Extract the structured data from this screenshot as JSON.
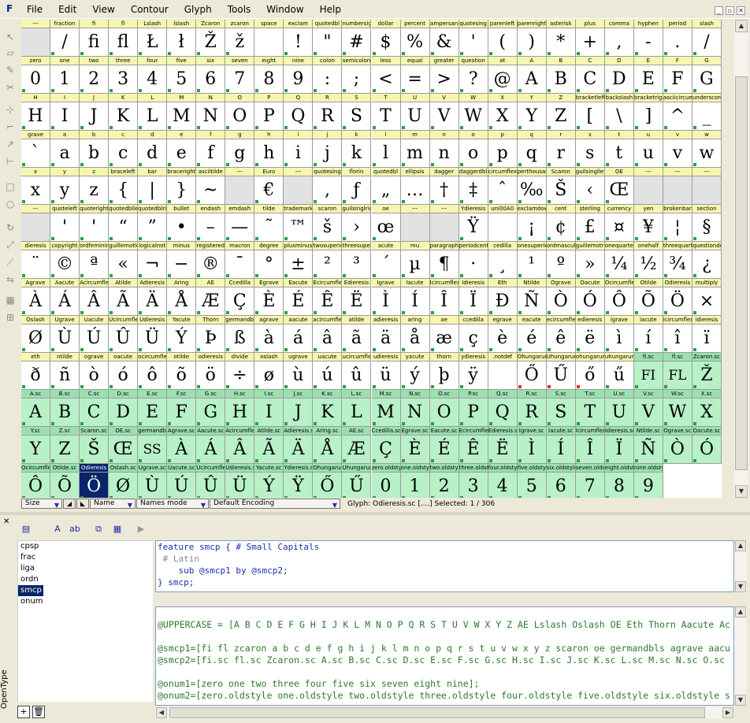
{
  "app": {
    "logo": "F",
    "menus": [
      "File",
      "Edit",
      "View",
      "Contour",
      "Glyph",
      "Tools",
      "Window",
      "Help"
    ]
  },
  "window_controls": [
    "minimize-icon",
    "restore-icon",
    "close-icon"
  ],
  "left_tools": [
    "pointer-icon",
    "eraser-icon",
    "pencil-icon",
    "knife-icon",
    "curve-point-icon",
    "corner-point-icon",
    "tangent-point-icon",
    "hv-point-icon",
    "rectangle-icon",
    "ellipse-icon",
    "rotate-icon",
    "scale-icon",
    "skew-icon",
    "flip-icon",
    "metrics-icon",
    "kern-icon"
  ],
  "glyph_grid": {
    "rows": [
      {
        "labels": [
          "---",
          "fraction",
          "fi",
          "fl",
          "Lslash",
          "lslash",
          "Zcaron",
          "zcaron",
          "space",
          "exclam",
          "quotedbl",
          "numbersig",
          "dollar",
          "percent",
          "ampersan",
          "quotesing",
          "parenleft",
          "parenright",
          "asterisk",
          "plus",
          "comma",
          "hyphen",
          "period",
          "slash"
        ],
        "glyphs": [
          "",
          "/",
          "fi",
          "fl",
          "Ł",
          "ł",
          "Ž",
          "ž",
          "",
          "!",
          "\"",
          "#",
          "$",
          "%",
          "&",
          "'",
          "(",
          ")",
          "*",
          "+",
          ",",
          "-",
          ".",
          "/"
        ]
      },
      {
        "labels": [
          "zero",
          "one",
          "two",
          "three",
          "four",
          "five",
          "six",
          "seven",
          "eight",
          "nine",
          "colon",
          "semicolon",
          "less",
          "equal",
          "greater",
          "question",
          "at",
          "A",
          "B",
          "C",
          "D",
          "E",
          "F",
          "G"
        ],
        "glyphs": [
          "0",
          "1",
          "2",
          "3",
          "4",
          "5",
          "6",
          "7",
          "8",
          "9",
          ":",
          ";",
          "<",
          "=",
          ">",
          "?",
          "@",
          "A",
          "B",
          "C",
          "D",
          "E",
          "F",
          "G"
        ]
      },
      {
        "labels": [
          "H",
          "I",
          "J",
          "K",
          "L",
          "M",
          "N",
          "O",
          "P",
          "Q",
          "R",
          "S",
          "T",
          "U",
          "V",
          "W",
          "X",
          "Y",
          "Z",
          "bracketleft",
          "backslash",
          "bracketright",
          "asciicircum",
          "underscore"
        ],
        "glyphs": [
          "H",
          "I",
          "J",
          "K",
          "L",
          "M",
          "N",
          "O",
          "P",
          "Q",
          "R",
          "S",
          "T",
          "U",
          "V",
          "W",
          "X",
          "Y",
          "Z",
          "[",
          "\\",
          "]",
          "^",
          "_"
        ]
      },
      {
        "labels": [
          "grave",
          "a",
          "b",
          "c",
          "d",
          "e",
          "f",
          "g",
          "h",
          "i",
          "j",
          "k",
          "l",
          "m",
          "n",
          "o",
          "p",
          "q",
          "r",
          "s",
          "t",
          "u",
          "v",
          "w"
        ],
        "glyphs": [
          "`",
          "a",
          "b",
          "c",
          "d",
          "e",
          "f",
          "g",
          "h",
          "i",
          "j",
          "k",
          "l",
          "m",
          "n",
          "o",
          "p",
          "q",
          "r",
          "s",
          "t",
          "u",
          "v",
          "w"
        ]
      },
      {
        "labels": [
          "x",
          "y",
          "z",
          "braceleft",
          "bar",
          "braceright",
          "asciitilde",
          "---",
          "Euro",
          "---",
          "quotesing",
          "florin",
          "quotedbl",
          "ellipsis",
          "dagger",
          "daggerdbl",
          "circumflex",
          "perthousand",
          "Scaron",
          "guilsinglleft",
          "OE",
          "---",
          "---",
          "---"
        ],
        "glyphs": [
          "x",
          "y",
          "z",
          "{",
          "|",
          "}",
          "~",
          "",
          "€",
          "",
          "‚",
          "ƒ",
          "„",
          "…",
          "†",
          "‡",
          "ˆ",
          "‰",
          "Š",
          "‹",
          "Œ",
          "",
          "",
          ""
        ]
      },
      {
        "labels": [
          "---",
          "quoteleft",
          "quoteright",
          "quotedblleft",
          "quotedblright",
          "bullet",
          "endash",
          "emdash",
          "tilde",
          "trademark",
          "scaron",
          "guilsinglright",
          "oe",
          "---",
          "---",
          "Ydieresis",
          "uni00A0",
          "exclamdown",
          "cent",
          "sterling",
          "currency",
          "yen",
          "brokenbar",
          "section"
        ],
        "glyphs": [
          "",
          "'",
          "'",
          "“",
          "”",
          "•",
          "–",
          "—",
          "˜",
          "™",
          "š",
          "›",
          "œ",
          "",
          "",
          "Ÿ",
          "",
          "¡",
          "¢",
          "£",
          "¤",
          "¥",
          "¦",
          "§"
        ]
      },
      {
        "labels": [
          "dieresis",
          "copyright",
          "ordfeminine",
          "guillemotleft",
          "logicalnot",
          "minus",
          "registered",
          "macron",
          "degree",
          "plusminus",
          "twosuperior",
          "threesuperior",
          "acute",
          "mu",
          "paragraph",
          "periodcentered",
          "cedilla",
          "onesuperior",
          "ordmasculine",
          "guillemotright",
          "onequarter",
          "onehalf",
          "threequarters",
          "questiondown"
        ],
        "glyphs": [
          "¨",
          "©",
          "ª",
          "«",
          "¬",
          "−",
          "®",
          "¯",
          "°",
          "±",
          "²",
          "³",
          "´",
          "µ",
          "¶",
          "·",
          "¸",
          "¹",
          "º",
          "»",
          "¼",
          "½",
          "¾",
          "¿"
        ]
      },
      {
        "labels": [
          "Agrave",
          "Aacute",
          "Acircumflex",
          "Atilde",
          "Adieresis",
          "Aring",
          "AE",
          "Ccedilla",
          "Egrave",
          "Eacute",
          "Ecircumflex",
          "Edieresis",
          "Igrave",
          "Iacute",
          "Icircumflex",
          "Idieresis",
          "Eth",
          "Ntilde",
          "Ograve",
          "Oacute",
          "Ocircumflex",
          "Otilde",
          "Odieresis",
          "multiply"
        ],
        "glyphs": [
          "À",
          "Á",
          "Â",
          "Ã",
          "Ä",
          "Å",
          "Æ",
          "Ç",
          "È",
          "É",
          "Ê",
          "Ë",
          "Ì",
          "Í",
          "Î",
          "Ï",
          "Ð",
          "Ñ",
          "Ò",
          "Ó",
          "Ô",
          "Õ",
          "Ö",
          "×"
        ]
      },
      {
        "labels": [
          "Oslash",
          "Ugrave",
          "Uacute",
          "Ucircumflex",
          "Udieresis",
          "Yacute",
          "Thorn",
          "germandbls",
          "agrave",
          "aacute",
          "acircumflex",
          "atilde",
          "adieresis",
          "aring",
          "ae",
          "ccedilla",
          "egrave",
          "eacute",
          "ecircumflex",
          "edieresis",
          "igrave",
          "iacute",
          "icircumflex",
          "idieresis"
        ],
        "glyphs": [
          "Ø",
          "Ù",
          "Ú",
          "Û",
          "Ü",
          "Ý",
          "Þ",
          "ß",
          "à",
          "á",
          "â",
          "ã",
          "ä",
          "å",
          "æ",
          "ç",
          "è",
          "é",
          "ê",
          "ë",
          "ì",
          "í",
          "î",
          "ï"
        ]
      },
      {
        "labels": [
          "eth",
          "ntilde",
          "ograve",
          "oacute",
          "ocircumflex",
          "otilde",
          "odieresis",
          "divide",
          "oslash",
          "ugrave",
          "uacute",
          "ucircumflex",
          "udieresis",
          "yacute",
          "thorn",
          "ydieresis",
          ".notdef",
          "Ohungarumlaut",
          "Uhungarumlaut",
          "ohungarumlaut",
          "uhungarumlaut",
          "fi.sc",
          "fl.sc",
          "Zcaron.sc"
        ],
        "glyphs": [
          "ð",
          "ñ",
          "ò",
          "ó",
          "ô",
          "õ",
          "ö",
          "÷",
          "ø",
          "ù",
          "ú",
          "û",
          "ü",
          "ý",
          "þ",
          "ÿ",
          "",
          "Ő",
          "Ű",
          "ő",
          "ű",
          "FI",
          "FL",
          "Ž"
        ]
      },
      {
        "labels": [
          "A.sc",
          "B.sc",
          "C.sc",
          "D.sc",
          "E.sc",
          "F.sc",
          "G.sc",
          "H.sc",
          "I.sc",
          "J.sc",
          "K.sc",
          "L.sc",
          "M.sc",
          "N.sc",
          "O.sc",
          "P.sc",
          "Q.sc",
          "R.sc",
          "S.sc",
          "T.sc",
          "U.sc",
          "V.sc",
          "W.sc",
          "X.sc"
        ],
        "glyphs": [
          "A",
          "B",
          "C",
          "D",
          "E",
          "F",
          "G",
          "H",
          "I",
          "J",
          "K",
          "L",
          "M",
          "N",
          "O",
          "P",
          "Q",
          "R",
          "S",
          "T",
          "U",
          "V",
          "W",
          "X"
        ]
      },
      {
        "labels": [
          "Y.sc",
          "Z.sc",
          "Scaron.sc",
          "OE.sc",
          "germandbls.sc",
          "Agrave.sc",
          "Aacute.sc",
          "Acircumflex.sc",
          "Atilde.sc",
          "Adieresis.sc",
          "Aring.sc",
          "AE.sc",
          "Ccedilla.sc",
          "Egrave.sc",
          "Eacute.sc",
          "Ecircumflex.sc",
          "Edieresis.sc",
          "Igrave.sc",
          "Iacute.sc",
          "Icircumflex.sc",
          "Idieresis.sc",
          "Ntilde.sc",
          "Ograve.sc",
          "Oacute.sc"
        ],
        "glyphs": [
          "Y",
          "Z",
          "Š",
          "Œ",
          "SS",
          "À",
          "Á",
          "Â",
          "Ã",
          "Ä",
          "Å",
          "Æ",
          "Ç",
          "È",
          "É",
          "Ê",
          "Ë",
          "Ì",
          "Í",
          "Î",
          "Ï",
          "Ñ",
          "Ò",
          "Ó"
        ]
      },
      {
        "labels": [
          "Ocircumflex.sc",
          "Otilde.sc",
          "Odieresis",
          "Oslash.sc",
          "Ugrave.sc",
          "Uacute.sc",
          "Ucircumflex.sc",
          "Udieresis.sc",
          "Yacute.sc",
          "Ydieresis.sc",
          "Ohungarumlaut.sc",
          "Uhungarumlaut.sc",
          "zero.oldstyle",
          "one.oldstyle",
          "two.oldstyle",
          "three.oldstyle",
          "four.oldstyle",
          "five.oldstyle",
          "six.oldstyle",
          "seven.oldstyle",
          "eight.oldstyle",
          "nine.oldstyle"
        ],
        "glyphs": [
          "Ô",
          "Õ",
          "Ö",
          "Ø",
          "Ù",
          "Ú",
          "Û",
          "Ü",
          "Ý",
          "Ÿ",
          "Ő",
          "Ű",
          "0",
          "1",
          "2",
          "3",
          "4",
          "5",
          "6",
          "7",
          "8",
          "9"
        ]
      }
    ],
    "highlight_color": "#f6f6b0",
    "sc_color": "#b8f0c8",
    "sc_label_color": "#9be0b0",
    "selected_color": "#0a246a",
    "empty_color": "#e2e2e2"
  },
  "statusbar": {
    "size": "Size",
    "name": "Name",
    "names_mode": "Names mode",
    "encoding": "Default Encoding",
    "glyph_info": "Glyph: Odieresis.sc [....]   Selected: 1 / 306"
  },
  "panel": {
    "tab_label": "OpenType",
    "features": [
      "cpsp",
      "frac",
      "liga",
      "ordn",
      "smcp",
      "onum"
    ],
    "selected_feature": "smcp",
    "code_lines": [
      "feature smcp { # Small Capitals",
      " # Latin",
      "    sub @smcp1 by @smcp2;",
      "} smcp;"
    ],
    "class_lines": [
      "",
      "@UPPERCASE = [A B C D E F G H I J K L M N O P Q R S T U V W X Y Z AE Lslash Oslash OE Eth Thorn Aacute Ac",
      "",
      "@smcp1=[fi fl zcaron a b c d e f g h i j k l m n o p q r s t u v w x y z scaron oe germandbls agrave aacu",
      "@smcp2=[fi.sc fl.sc Zcaron.sc A.sc B.sc C.sc D.sc E.sc F.sc G.sc H.sc I.sc J.sc K.sc L.sc M.sc N.sc O.sc",
      "",
      "@onum1=[zero one two three four five six seven eight nine];",
      "@onum2=[zero.oldstyle one.oldstyle two.oldstyle three.oldstyle four.oldstyle five.oldstyle six.oldstyle s"
    ],
    "toolbar": [
      "close-panel-icon",
      "import-icon",
      "font-a-icon",
      "font-ab-icon",
      "compile-icon",
      "validate-icon",
      "run-icon"
    ]
  }
}
